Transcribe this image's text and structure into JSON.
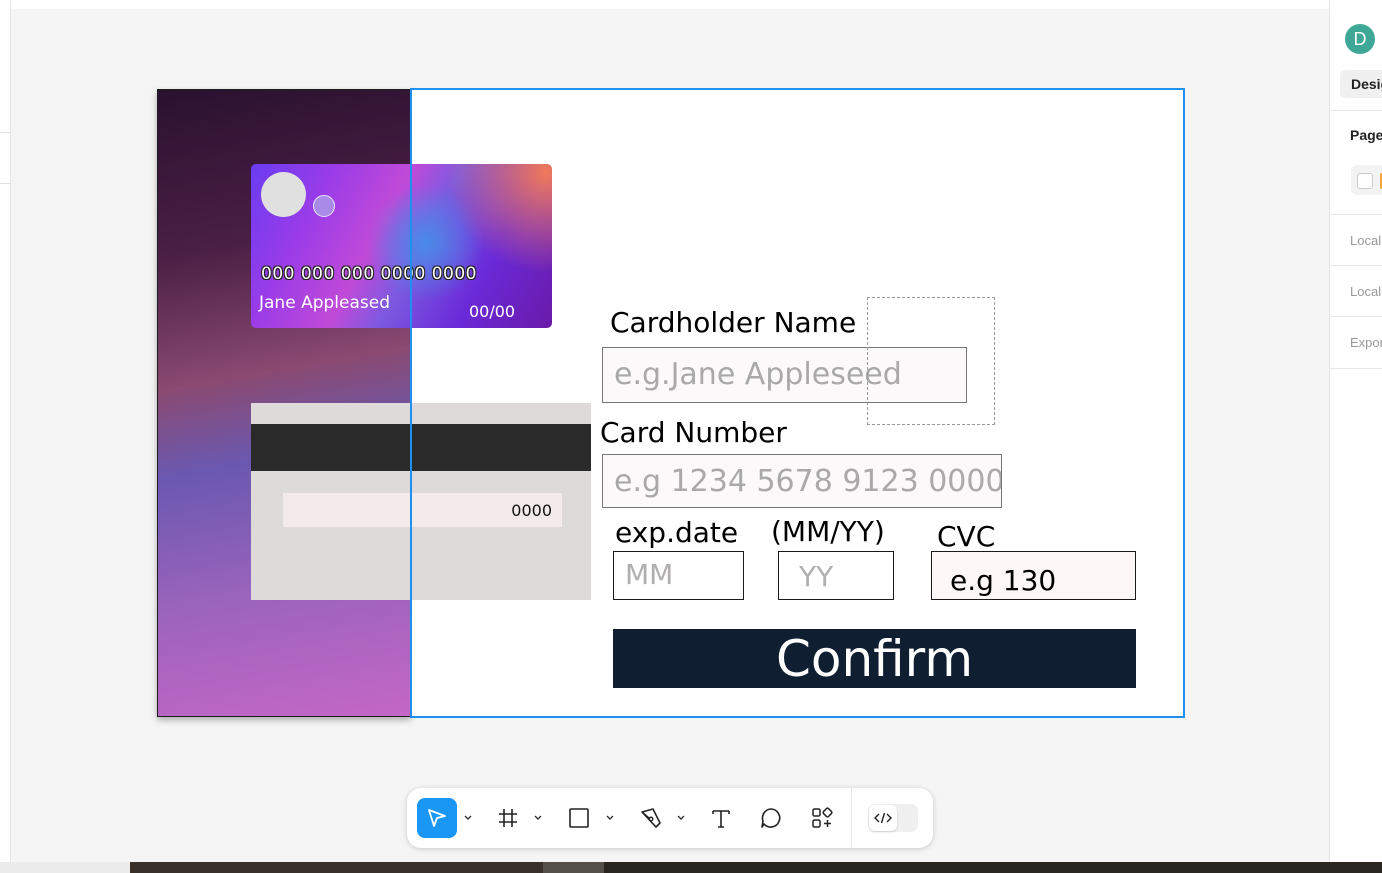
{
  "app": {
    "user_initial": "D",
    "design_tab": "Design"
  },
  "right_panel": {
    "sections": [
      "Page",
      "Local",
      "Local",
      "Export"
    ]
  },
  "card_front": {
    "number": "000 000 000 0000 0000",
    "name": "Jane Appleased",
    "expiry": "00/00"
  },
  "card_back": {
    "cvc": "0000"
  },
  "form": {
    "cardholder_label": "Cardholder Name",
    "cardholder_placeholder": "e.g.Jane Appleseed",
    "card_number_label": "Card Number",
    "card_number_placeholder": "e.g 1234 5678 9123 0000",
    "exp_label": "exp.date",
    "exp_format_label": "(MM/YY)",
    "mm_placeholder": "MM",
    "yy_placeholder": "YY",
    "cvc_label": "CVC",
    "cvc_placeholder": "e.g 130",
    "confirm_label": "Confirm"
  },
  "toolbar": {
    "tools": [
      "move-tool",
      "frame-tool",
      "shape-tool",
      "pen-tool",
      "text-tool",
      "comment-tool",
      "actions-tool",
      "dev-mode-toggle"
    ],
    "accent": "#1a96f5"
  },
  "colors": {
    "selection": "#1e90f0",
    "confirm_bg": "#0f1f31",
    "avatar": "#3ea796"
  }
}
